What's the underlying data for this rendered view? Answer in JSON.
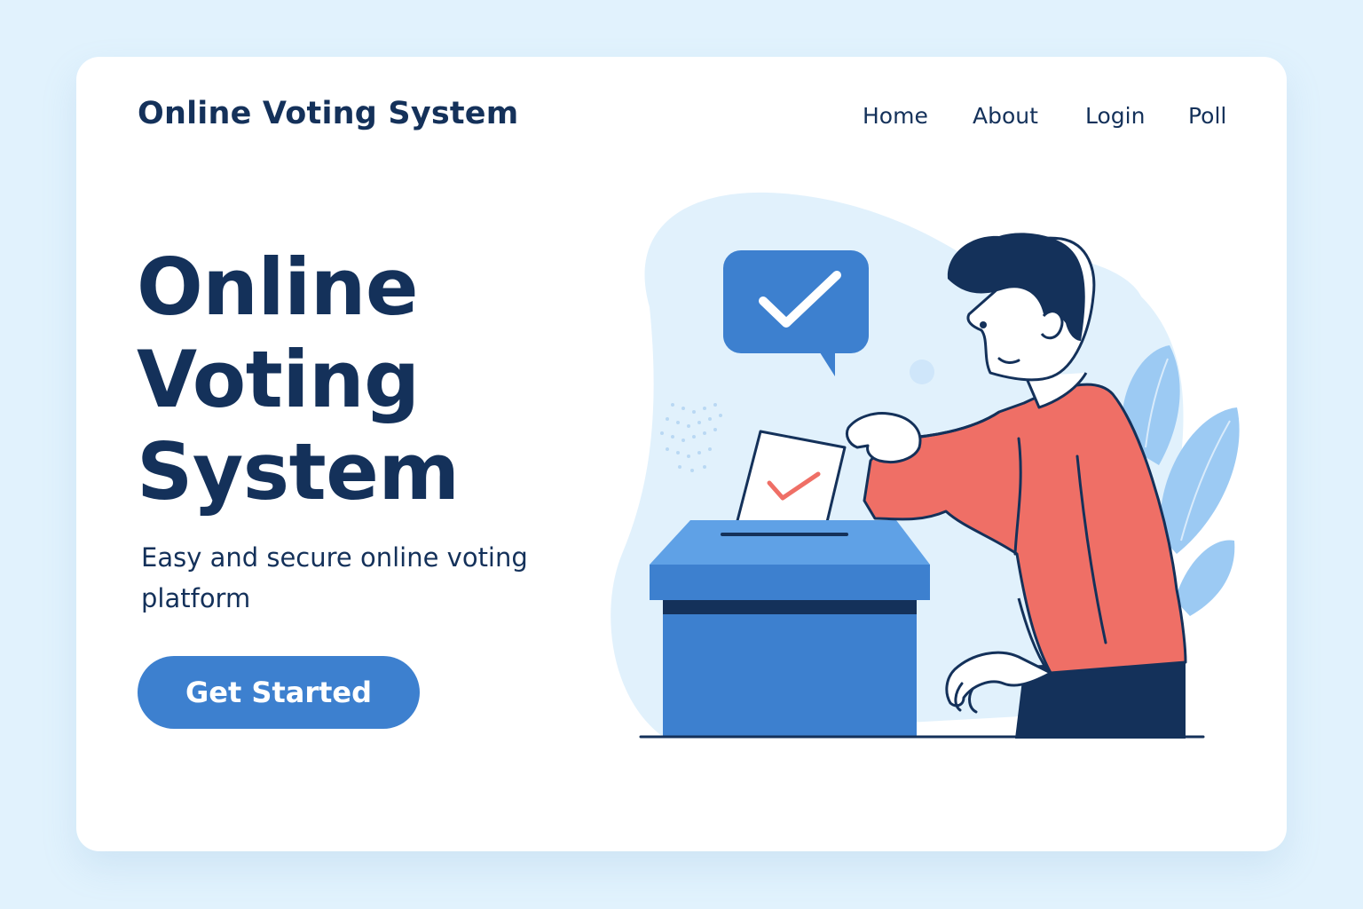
{
  "header": {
    "brand": "Online Voting System",
    "nav": [
      "Home",
      "About",
      "Login",
      "Poll"
    ]
  },
  "hero": {
    "title_lines": [
      "Online",
      "Voting",
      "System"
    ],
    "subtitle": "Easy and secure online voting platform",
    "cta_label": "Get Started"
  },
  "colors": {
    "background": "#e1f2fd",
    "text_dark": "#14315a",
    "accent_blue": "#3d80cf",
    "shirt": "#ef6f66"
  },
  "icons": [
    "check-icon",
    "ballot-box",
    "voter-figure"
  ]
}
